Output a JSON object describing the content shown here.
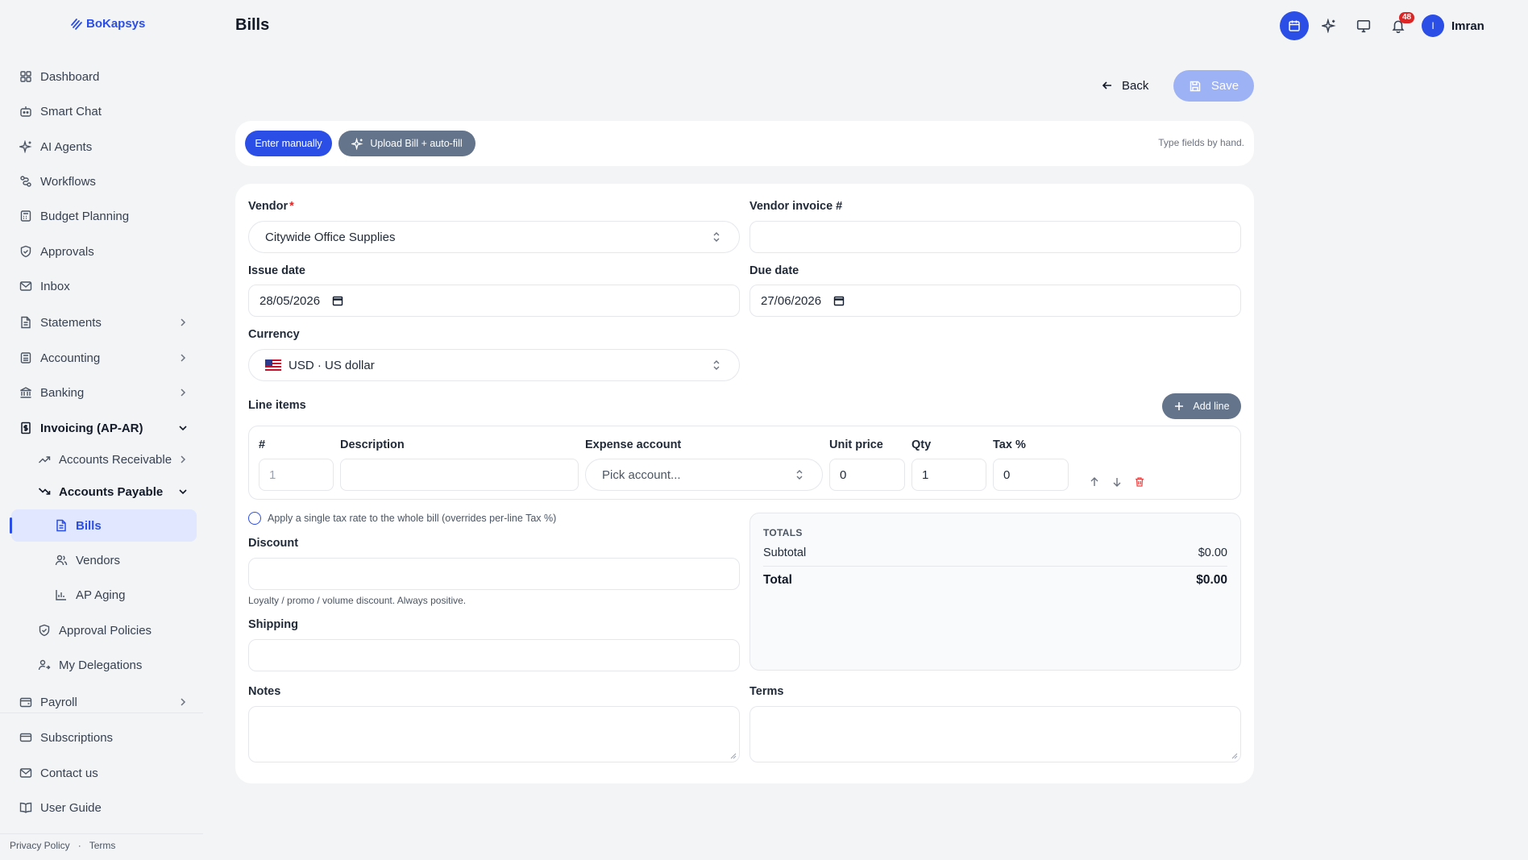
{
  "app": {
    "logo_text": "BoKapsys"
  },
  "sidebar": {
    "items": [
      {
        "label": "Dashboard",
        "icon": "grid-icon"
      },
      {
        "label": "Smart Chat",
        "icon": "bot-icon"
      },
      {
        "label": "AI Agents",
        "icon": "sparkles-icon"
      },
      {
        "label": "Workflows",
        "icon": "workflow-icon"
      },
      {
        "label": "Budget Planning",
        "icon": "calculator-icon"
      },
      {
        "label": "Approvals",
        "icon": "shield-check-icon"
      },
      {
        "label": "Inbox",
        "icon": "mail-icon"
      },
      {
        "label": "Statements",
        "icon": "file-icon"
      },
      {
        "label": "Accounting",
        "icon": "calculator-icon"
      },
      {
        "label": "Banking",
        "icon": "bank-icon"
      },
      {
        "label": "Invoicing (AP-AR)",
        "icon": "receipt-icon"
      },
      {
        "label": "Accounts Receivable",
        "icon": "trending-up-icon"
      },
      {
        "label": "Accounts Payable",
        "icon": "trending-down-icon"
      },
      {
        "label": "Bills",
        "icon": "file-text-icon"
      },
      {
        "label": "Vendors",
        "icon": "users-icon"
      },
      {
        "label": "AP Aging",
        "icon": "bar-chart-icon"
      },
      {
        "label": "Approval Policies",
        "icon": "shield-check-icon"
      },
      {
        "label": "My Delegations",
        "icon": "user-switch-icon"
      },
      {
        "label": "Payroll",
        "icon": "wallet-icon"
      },
      {
        "label": "Subscriptions",
        "icon": "credit-card-icon"
      },
      {
        "label": "Contact us",
        "icon": "mail-icon"
      },
      {
        "label": "User Guide",
        "icon": "book-icon"
      }
    ],
    "footer": {
      "privacy": "Privacy Policy",
      "dot": "·",
      "terms": "Terms"
    }
  },
  "header": {
    "title": "Bills",
    "notification_count": "48",
    "user_initial": "I",
    "user_name": "Imran"
  },
  "actions": {
    "back_label": "Back",
    "save_label": "Save"
  },
  "mode": {
    "manual_label": "Enter manually",
    "upload_label": "Upload Bill + auto-fill",
    "hint": "Type fields by hand."
  },
  "form": {
    "vendor_label": "Vendor",
    "vendor_required": "*",
    "vendor_value": "Citywide Office Supplies",
    "vendor_invoice_label": "Vendor invoice #",
    "vendor_invoice_value": "",
    "issue_date_label": "Issue date",
    "issue_date_value": "28/05/2026",
    "due_date_label": "Due date",
    "due_date_value": "27/06/2026",
    "currency_label": "Currency",
    "currency_value": "USD · US dollar",
    "line_items_label": "Line items",
    "add_line_label": "Add line",
    "line_columns": [
      "#",
      "Description",
      "Expense account",
      "Unit price",
      "Qty",
      "Tax %"
    ],
    "line_row": {
      "index": "1",
      "description": "",
      "account_placeholder": "Pick account...",
      "unit_price": "0",
      "qty": "1",
      "tax": "0"
    },
    "single_tax_label": "Apply a single tax rate to the whole bill (overrides per-line Tax %)",
    "discount_label": "Discount",
    "discount_help": "Loyalty / promo / volume discount. Always positive.",
    "shipping_label": "Shipping",
    "notes_label": "Notes",
    "terms_label": "Terms"
  },
  "totals": {
    "caption": "TOTALS",
    "subtotal_label": "Subtotal",
    "subtotal_value": "$0.00",
    "total_label": "Total",
    "total_value": "$0.00"
  },
  "colors": {
    "accent": "#2b4ee6",
    "muted_pill": "#64748b",
    "badge": "#dc2626"
  }
}
